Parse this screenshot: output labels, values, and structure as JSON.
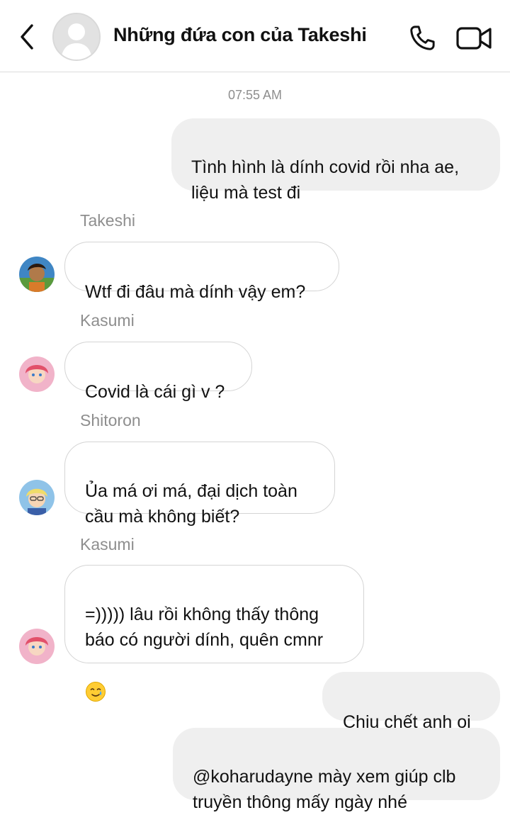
{
  "header": {
    "title": "Những đứa con của Takeshi",
    "icons": {
      "back": "chevron-left-icon",
      "avatar": "group-avatar-placeholder",
      "call": "phone-icon",
      "video": "video-camera-icon"
    }
  },
  "chat": {
    "timestamp": "07:55 AM",
    "messages": [
      {
        "direction": "outgoing",
        "text": "Tình hình là dính covid rồi nha ae,\nliệu mà test đi"
      },
      {
        "direction": "incoming",
        "sender": "Takeshi",
        "text": "Wtf đi đâu mà dính vậy em?"
      },
      {
        "direction": "incoming",
        "sender": "Kasumi",
        "text": "Covid là cái gì v ?"
      },
      {
        "direction": "incoming",
        "sender": "Shitoron",
        "text": "Ủa má ơi má, đại dịch toàn\ncầu mà không biết?"
      },
      {
        "direction": "incoming",
        "sender": "Kasumi",
        "text": "=))))) lâu rồi không thấy thông\nbáo có người dính, quên cmnr",
        "emoji": "smiling-face-with-tear-emoji"
      },
      {
        "direction": "outgoing",
        "text": "Chịu chết anh oi"
      },
      {
        "direction": "outgoing",
        "text": "@koharudayne mày xem giúp clb\ntruyền thông mấy ngày nhé"
      }
    ]
  },
  "colors": {
    "outgoing_bubble": "#efefef",
    "incoming_border": "#d4d4d4",
    "meta_text": "#8e8e8e"
  }
}
